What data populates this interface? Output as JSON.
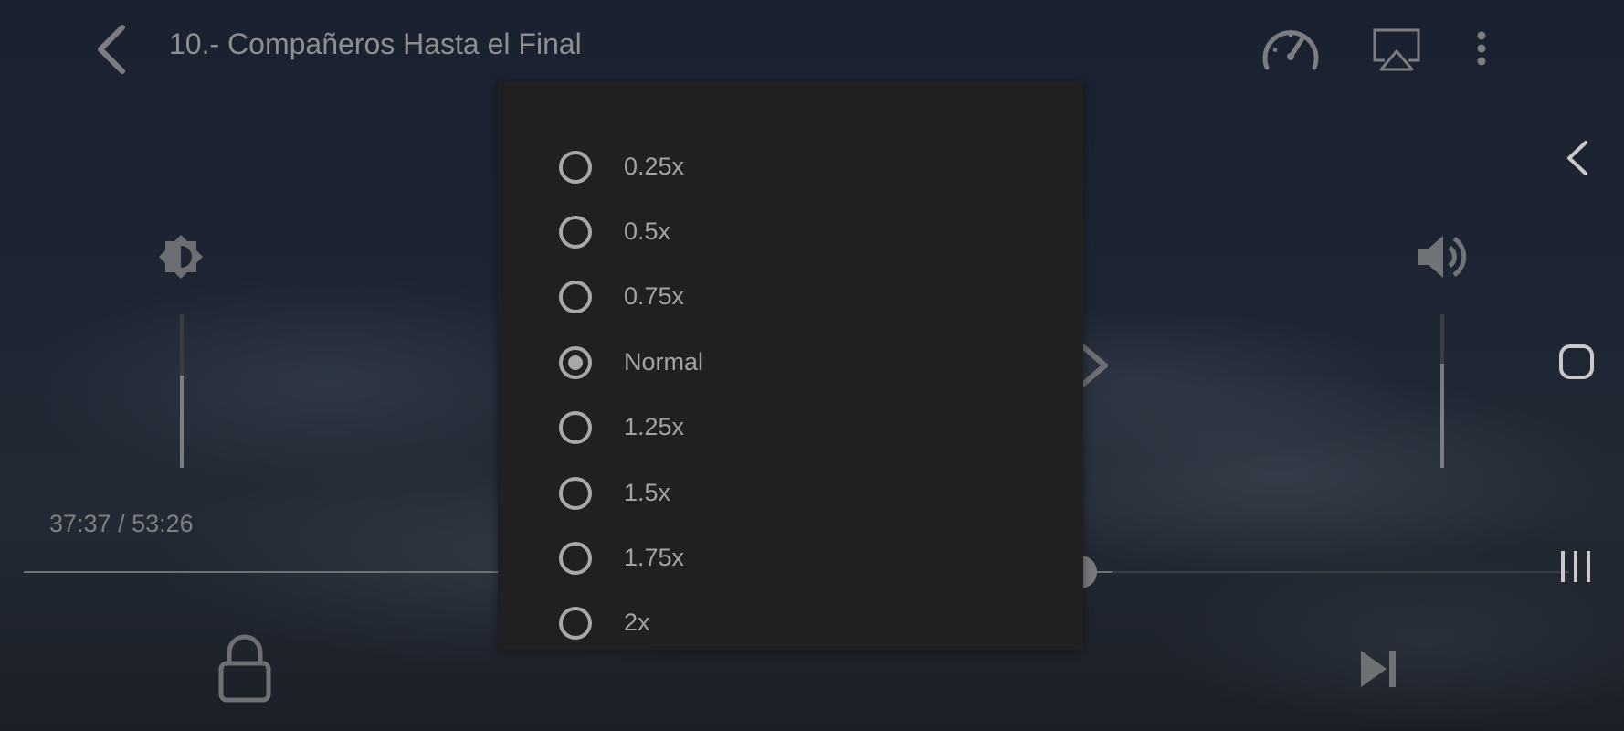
{
  "player": {
    "title": "10.- Compañeros Hasta el Final",
    "time": "37:37 / 53:26",
    "progress_fraction": 0.704,
    "brightness_level": 0.6,
    "volume_level": 0.68
  },
  "icons": {
    "back": "back-arrow-icon",
    "speed": "speedometer-icon",
    "cast": "airplay-icon",
    "more": "more-vert-icon",
    "brightness": "brightness-icon",
    "volume": "volume-icon",
    "lock": "lock-icon",
    "next": "skip-next-icon",
    "nav_back": "nav-back-icon",
    "nav_home": "nav-home-icon",
    "nav_recents": "nav-recents-icon"
  },
  "speed_menu": {
    "options": [
      {
        "label": "0.25x",
        "selected": false
      },
      {
        "label": "0.5x",
        "selected": false
      },
      {
        "label": "0.75x",
        "selected": false
      },
      {
        "label": "Normal",
        "selected": true
      },
      {
        "label": "1.25x",
        "selected": false
      },
      {
        "label": "1.5x",
        "selected": false
      },
      {
        "label": "1.75x",
        "selected": false
      },
      {
        "label": "2x",
        "selected": false
      }
    ]
  },
  "colors": {
    "menu_background": "#202020",
    "control_gray": "#8e8f91"
  }
}
